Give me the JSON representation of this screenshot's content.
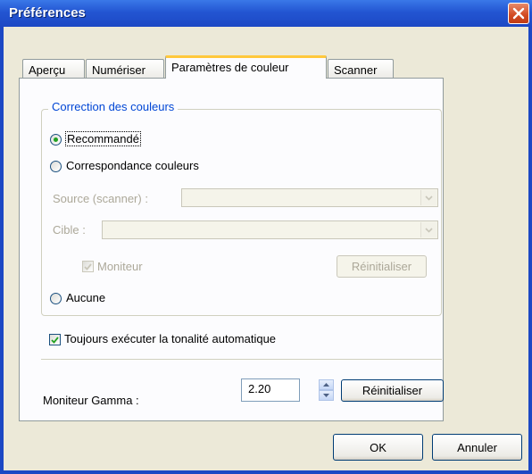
{
  "window": {
    "title": "Préférences"
  },
  "tabs": [
    {
      "label": "Aperçu"
    },
    {
      "label": "Numériser"
    },
    {
      "label": "Paramètres de couleur"
    },
    {
      "label": "Scanner"
    }
  ],
  "color_correction": {
    "group_label": "Correction des couleurs",
    "options": {
      "recommended": {
        "label": "Recommandé",
        "checked": true
      },
      "color_matching": {
        "label": "Correspondance couleurs",
        "checked": false
      },
      "none": {
        "label": "Aucune",
        "checked": false
      }
    },
    "source_label": "Source (scanner) :",
    "source_value": "",
    "target_label": "Cible :",
    "target_value": "",
    "monitor_label": "Moniteur",
    "monitor_checked": true,
    "reset_label": "Réinitialiser"
  },
  "auto_tone": {
    "label": "Toujours exécuter la tonalité automatique",
    "checked": true
  },
  "gamma": {
    "label": "Moniteur Gamma  :",
    "value": "2.20",
    "reset_label": "Réinitialiser"
  },
  "buttons": {
    "ok": "OK",
    "cancel": "Annuler"
  },
  "colors": {
    "titlebar": "#2355D2",
    "group_label": "#0046D5",
    "active_tab_accent": "#FFC83C",
    "radio_dot": "#21A121"
  }
}
